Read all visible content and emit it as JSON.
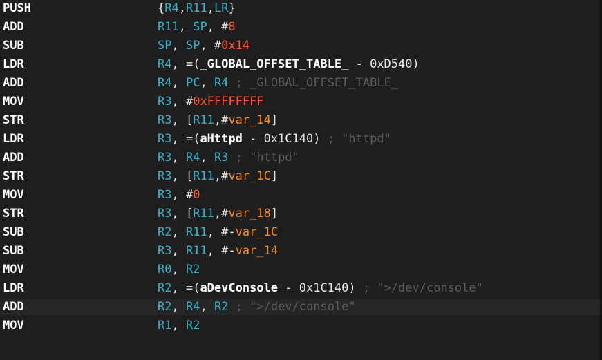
{
  "lines": [
    {
      "mnemonic": "PUSH",
      "operands": [
        {
          "t": "{",
          "c": "txt"
        },
        {
          "t": "R4",
          "c": "reg"
        },
        {
          "t": ",",
          "c": "txt"
        },
        {
          "t": "R11",
          "c": "reg"
        },
        {
          "t": ",",
          "c": "txt"
        },
        {
          "t": "LR",
          "c": "reg"
        },
        {
          "t": "}",
          "c": "txt"
        }
      ]
    },
    {
      "mnemonic": "ADD",
      "operands": [
        {
          "t": "R11",
          "c": "reg"
        },
        {
          "t": ", ",
          "c": "txt"
        },
        {
          "t": "SP",
          "c": "reg"
        },
        {
          "t": ", #",
          "c": "txt"
        },
        {
          "t": "8",
          "c": "num"
        }
      ]
    },
    {
      "mnemonic": "SUB",
      "operands": [
        {
          "t": "SP",
          "c": "reg"
        },
        {
          "t": ", ",
          "c": "txt"
        },
        {
          "t": "SP",
          "c": "reg"
        },
        {
          "t": ", #",
          "c": "txt"
        },
        {
          "t": "0x14",
          "c": "num"
        }
      ]
    },
    {
      "mnemonic": "LDR",
      "operands": [
        {
          "t": "R4",
          "c": "reg"
        },
        {
          "t": ", =(",
          "c": "txt"
        },
        {
          "t": "_GLOBAL_OFFSET_TABLE_",
          "c": "sym"
        },
        {
          "t": " - 0xD540)",
          "c": "txt"
        }
      ]
    },
    {
      "mnemonic": "ADD",
      "operands": [
        {
          "t": "R4",
          "c": "reg"
        },
        {
          "t": ", ",
          "c": "txt"
        },
        {
          "t": "PC",
          "c": "reg"
        },
        {
          "t": ", ",
          "c": "txt"
        },
        {
          "t": "R4",
          "c": "reg"
        },
        {
          "t": " ; _GLOBAL_OFFSET_TABLE_",
          "c": "cmt"
        }
      ]
    },
    {
      "mnemonic": "MOV",
      "operands": [
        {
          "t": "R3",
          "c": "reg"
        },
        {
          "t": ", #",
          "c": "txt"
        },
        {
          "t": "0xFFFFFFFF",
          "c": "num"
        }
      ]
    },
    {
      "mnemonic": "STR",
      "operands": [
        {
          "t": "R3",
          "c": "reg"
        },
        {
          "t": ", [",
          "c": "txt"
        },
        {
          "t": "R11",
          "c": "reg"
        },
        {
          "t": ",#",
          "c": "txt"
        },
        {
          "t": "var_14",
          "c": "var"
        },
        {
          "t": "]",
          "c": "txt"
        }
      ]
    },
    {
      "mnemonic": "LDR",
      "operands": [
        {
          "t": "R3",
          "c": "reg"
        },
        {
          "t": ", =(",
          "c": "txt"
        },
        {
          "t": "aHttpd",
          "c": "sym"
        },
        {
          "t": " - 0x1C140)",
          "c": "txt"
        },
        {
          "t": " ; \"httpd\"",
          "c": "cmt"
        }
      ]
    },
    {
      "mnemonic": "ADD",
      "operands": [
        {
          "t": "R3",
          "c": "reg"
        },
        {
          "t": ", ",
          "c": "txt"
        },
        {
          "t": "R4",
          "c": "reg"
        },
        {
          "t": ", ",
          "c": "txt"
        },
        {
          "t": "R3",
          "c": "reg"
        },
        {
          "t": " ; \"httpd\"",
          "c": "cmt"
        }
      ]
    },
    {
      "mnemonic": "STR",
      "operands": [
        {
          "t": "R3",
          "c": "reg"
        },
        {
          "t": ", [",
          "c": "txt"
        },
        {
          "t": "R11",
          "c": "reg"
        },
        {
          "t": ",#",
          "c": "txt"
        },
        {
          "t": "var_1C",
          "c": "var"
        },
        {
          "t": "]",
          "c": "txt"
        }
      ]
    },
    {
      "mnemonic": "MOV",
      "operands": [
        {
          "t": "R3",
          "c": "reg"
        },
        {
          "t": ", #",
          "c": "txt"
        },
        {
          "t": "0",
          "c": "num"
        }
      ]
    },
    {
      "mnemonic": "STR",
      "operands": [
        {
          "t": "R3",
          "c": "reg"
        },
        {
          "t": ", [",
          "c": "txt"
        },
        {
          "t": "R11",
          "c": "reg"
        },
        {
          "t": ",#",
          "c": "txt"
        },
        {
          "t": "var_18",
          "c": "var"
        },
        {
          "t": "]",
          "c": "txt"
        }
      ]
    },
    {
      "mnemonic": "SUB",
      "operands": [
        {
          "t": "R2",
          "c": "reg"
        },
        {
          "t": ", ",
          "c": "txt"
        },
        {
          "t": "R11",
          "c": "reg"
        },
        {
          "t": ", #-",
          "c": "txt"
        },
        {
          "t": "var_1C",
          "c": "var"
        }
      ]
    },
    {
      "mnemonic": "SUB",
      "operands": [
        {
          "t": "R3",
          "c": "reg"
        },
        {
          "t": ", ",
          "c": "txt"
        },
        {
          "t": "R11",
          "c": "reg"
        },
        {
          "t": ", #-",
          "c": "txt"
        },
        {
          "t": "var_14",
          "c": "var"
        }
      ]
    },
    {
      "mnemonic": "MOV",
      "operands": [
        {
          "t": "R0",
          "c": "reg"
        },
        {
          "t": ", ",
          "c": "txt"
        },
        {
          "t": "R2",
          "c": "reg"
        }
      ]
    },
    {
      "mnemonic": "LDR",
      "operands": [
        {
          "t": "R2",
          "c": "reg"
        },
        {
          "t": ", =(",
          "c": "txt"
        },
        {
          "t": "aDevConsole",
          "c": "sym"
        },
        {
          "t": " - 0x1C140)",
          "c": "txt"
        },
        {
          "t": " ; \">/dev/console\"",
          "c": "cmt"
        }
      ]
    },
    {
      "mnemonic": "ADD",
      "highlighted": true,
      "operands": [
        {
          "t": "R2",
          "c": "reg"
        },
        {
          "t": ", ",
          "c": "txt"
        },
        {
          "t": "R4",
          "c": "reg"
        },
        {
          "t": ", ",
          "c": "txt"
        },
        {
          "t": "R2",
          "c": "reg"
        },
        {
          "t": " ; \">/dev/console\"",
          "c": "cmt"
        }
      ]
    },
    {
      "mnemonic": "MOV",
      "operands": [
        {
          "t": "R1",
          "c": "reg"
        },
        {
          "t": ", ",
          "c": "txt"
        },
        {
          "t": "R2",
          "c": "reg"
        }
      ]
    }
  ]
}
